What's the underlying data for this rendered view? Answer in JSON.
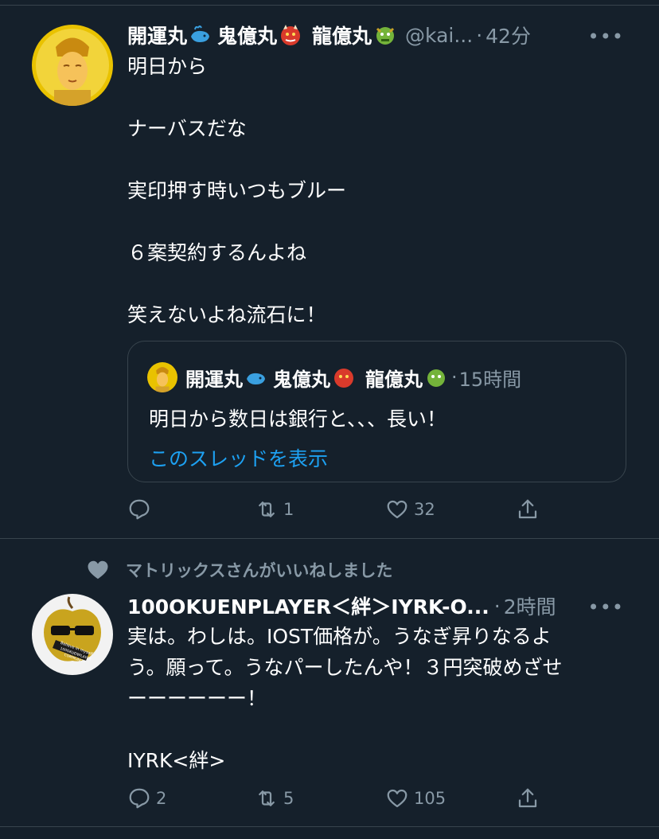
{
  "colors": {
    "background": "#15202b",
    "text": "#ffffff",
    "muted": "#8899a6",
    "link": "#1da1f2",
    "border": "#38444d"
  },
  "tweet1": {
    "display_name": "開運丸",
    "name_part2": "鬼億丸",
    "name_part3": "龍億丸",
    "emojis": [
      "whale-emoji",
      "ogre-emoji",
      "dragon-emoji"
    ],
    "handle": "@kai...",
    "dot": "·",
    "time": "42分",
    "more": "•••",
    "lines": [
      "明日から",
      "",
      "ナーバスだな",
      "",
      "実印押す時いつもブルー",
      "",
      "６案契約するんよね",
      "",
      "笑えないよね流石に！"
    ],
    "quote": {
      "display_name": "開運丸",
      "name_part2": "鬼億丸",
      "name_part3": "龍億丸",
      "dot": "·",
      "time": "15時間",
      "text": "明日から数日は銀行と、、、長い！",
      "show_thread": "このスレッドを表示"
    },
    "actions": {
      "reply": "",
      "retweet": "1",
      "like": "32"
    }
  },
  "tweet2": {
    "context": "マトリックスさんがいいねしました",
    "display_name": "100OKUENPLAYER＜絆＞IYRK-O...",
    "dot": "·",
    "time": "2時間",
    "more": "•••",
    "lines": [
      "実は。わしは。IOST価格が。うなぎ昇りなるよ",
      "う。願って。うなパーしたんや！３円突破めざせ",
      "ーーーーーー！",
      "",
      "IYRK<絆>"
    ],
    "avatar_text": [
      "Believe in myself",
      "100OKUENPLAYER",
      "COMMUNITY"
    ],
    "actions": {
      "reply": "2",
      "retweet": "5",
      "like": "105"
    }
  }
}
